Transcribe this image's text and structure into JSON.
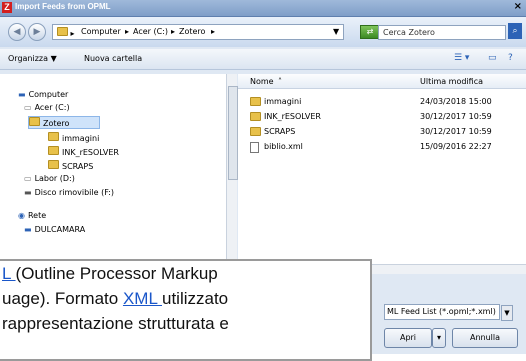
{
  "window": {
    "title": "Import Feeds from OPML",
    "close": "×"
  },
  "address": {
    "back_icon": "◀",
    "forward_icon": "▶",
    "crumbs": [
      "Computer",
      "Acer (C:)",
      "Zotero"
    ],
    "search_placeholder": "Cerca Zotero"
  },
  "toolbar": {
    "organize": "Organizza ▼",
    "new_folder": "Nuova cartella"
  },
  "tree": {
    "items": [
      "Computer",
      "Acer (C:)",
      "Zotero",
      "immagini",
      "INK_rESOLVER",
      "SCRAPS",
      "Labor (D:)",
      "Disco rimovibile (F:)",
      "Rete",
      "DULCAMARA"
    ]
  },
  "list": {
    "headers": {
      "name": "Nome",
      "modified": "Ultima modifica"
    },
    "rows": [
      {
        "name": "immagini",
        "date": "24/03/2018 15:00"
      },
      {
        "name": "INK_rESOLVER",
        "date": "30/12/2017 10:59"
      },
      {
        "name": "SCRAPS",
        "date": "30/12/2017 10:59"
      },
      {
        "name": "biblio.xml",
        "date": "15/09/2016 22:27"
      }
    ]
  },
  "footer": {
    "filter": "ML Feed List (*.opml;*.xml)",
    "open": "Apri",
    "cancel": "Annulla"
  },
  "callout": {
    "l1a": "L ",
    "l1b": "(Outline Processor Markup",
    "l2a": "uage).  Formato ",
    "l2link": "XML ",
    "l2b": "utilizzato",
    "l3": " rappresentazione strutturata e"
  }
}
